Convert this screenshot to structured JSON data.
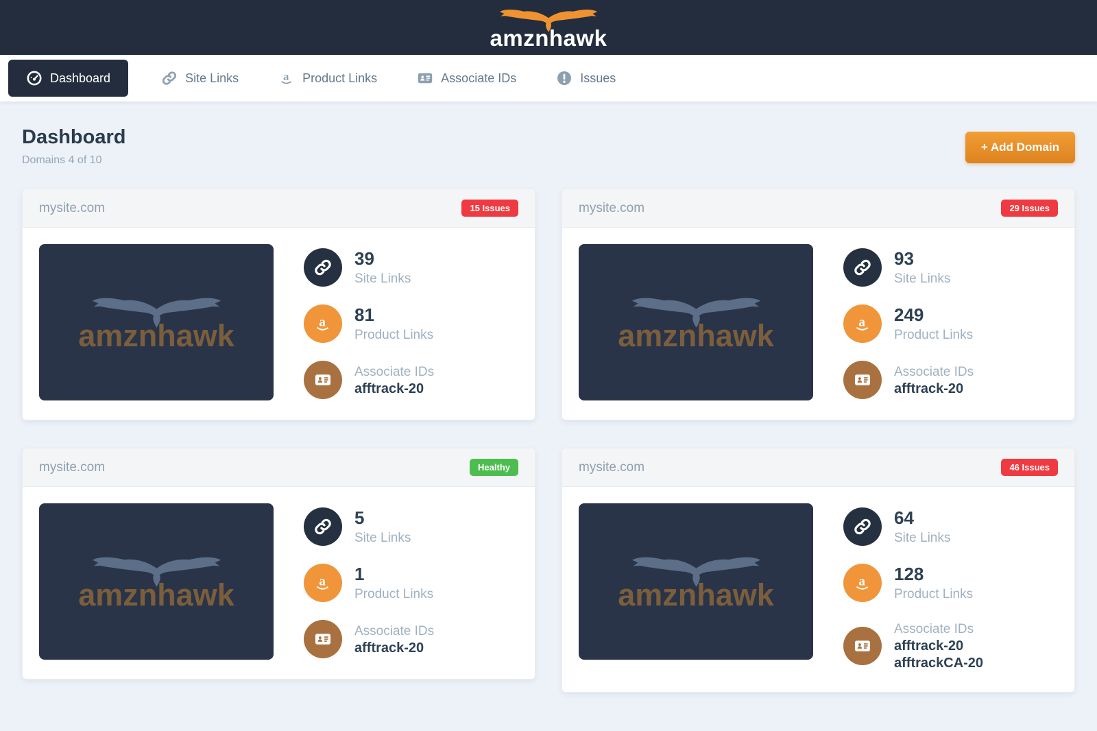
{
  "brand": {
    "name": "amznhawk"
  },
  "nav": {
    "items": [
      {
        "label": "Dashboard"
      },
      {
        "label": "Site Links"
      },
      {
        "label": "Product Links"
      },
      {
        "label": "Associate IDs"
      },
      {
        "label": "Issues"
      }
    ]
  },
  "page": {
    "title": "Dashboard",
    "subtitle": "Domains 4 of 10",
    "add_domain": "+ Add Domain"
  },
  "labels": {
    "site_links": "Site Links",
    "product_links": "Product Links",
    "associate_ids": "Associate IDs"
  },
  "cards": [
    {
      "domain": "mysite.com",
      "badge": "15 Issues",
      "status": "issues",
      "site_links": "39",
      "product_links": "81",
      "ids": [
        "afftrack-20"
      ]
    },
    {
      "domain": "mysite.com",
      "badge": "29 Issues",
      "status": "issues",
      "site_links": "93",
      "product_links": "249",
      "ids": [
        "afftrack-20"
      ]
    },
    {
      "domain": "mysite.com",
      "badge": "Healthy",
      "status": "healthy",
      "site_links": "5",
      "product_links": "1",
      "ids": [
        "afftrack-20"
      ]
    },
    {
      "domain": "mysite.com",
      "badge": "46 Issues",
      "status": "issues",
      "site_links": "64",
      "product_links": "128",
      "ids": [
        "afftrack-20",
        "afftrackCA-20"
      ]
    }
  ],
  "colors": {
    "header_bg": "#232d3d",
    "accent_orange": "#ef9231",
    "badge_red": "#ee3a40",
    "badge_green": "#4dbd50",
    "circle_dark": "#253140",
    "circle_orange": "#f0953a",
    "circle_brown": "#a9713f"
  }
}
